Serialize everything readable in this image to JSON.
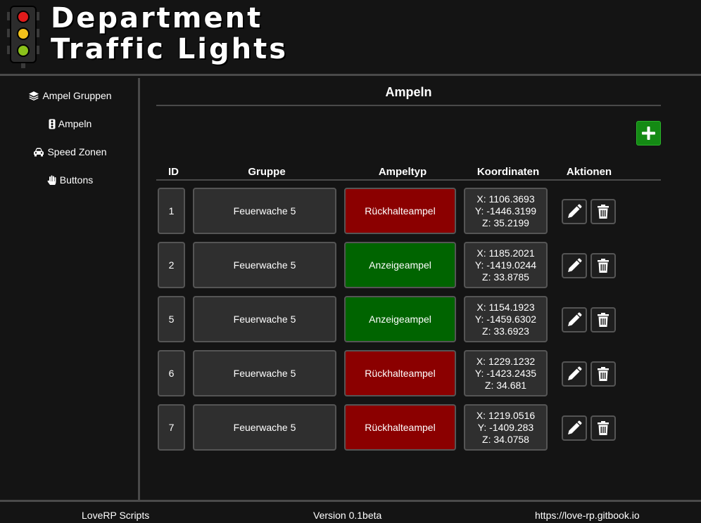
{
  "header": {
    "title_line1": "Department",
    "title_line2": "Traffic Lights",
    "logo_icon": "traffic-light-icon"
  },
  "sidebar": {
    "items": [
      {
        "label": "Ampel Gruppen",
        "icon": "layers-icon"
      },
      {
        "label": "Ampeln",
        "icon": "traffic-light-icon"
      },
      {
        "label": "Speed Zonen",
        "icon": "car-icon"
      },
      {
        "label": "Buttons",
        "icon": "hand-icon"
      }
    ]
  },
  "main": {
    "title": "Ampeln",
    "add_icon": "plus-icon",
    "columns": [
      "ID",
      "Gruppe",
      "Ampeltyp",
      "Koordinaten",
      "Aktionen"
    ],
    "rows": [
      {
        "id": "1",
        "group": "Feuerwache 5",
        "type": "Rückhalteampel",
        "type_color": "#8b0000",
        "x": "X: 1106.3693",
        "y": "Y: -1446.3199",
        "z": "Z: 35.2199"
      },
      {
        "id": "2",
        "group": "Feuerwache 5",
        "type": "Anzeigeampel",
        "type_color": "#006400",
        "x": "X: 1185.2021",
        "y": "Y: -1419.0244",
        "z": "Z: 33.8785"
      },
      {
        "id": "5",
        "group": "Feuerwache 5",
        "type": "Anzeigeampel",
        "type_color": "#006400",
        "x": "X: 1154.1923",
        "y": "Y: -1459.6302",
        "z": "Z: 33.6923"
      },
      {
        "id": "6",
        "group": "Feuerwache 5",
        "type": "Rückhalteampel",
        "type_color": "#8b0000",
        "x": "X: 1229.1232",
        "y": "Y: -1423.2435",
        "z": "Z: 34.681"
      },
      {
        "id": "7",
        "group": "Feuerwache 5",
        "type": "Rückhalteampel",
        "type_color": "#8b0000",
        "x": "X: 1219.0516",
        "y": "Y: -1409.283",
        "z": "Z: 34.0758"
      }
    ],
    "action_icons": [
      "pencil-icon",
      "trash-icon"
    ]
  },
  "footer": {
    "left": "LoveRP Scripts",
    "center": "Version 0.1beta",
    "right": "https://love-rp.gitbook.io"
  },
  "colors": {
    "background": "#141414",
    "border": "#4a4a4a",
    "cell": "#2f2f2f",
    "red_type": "#8b0000",
    "green_type": "#006400",
    "add_button": "#148a14"
  }
}
